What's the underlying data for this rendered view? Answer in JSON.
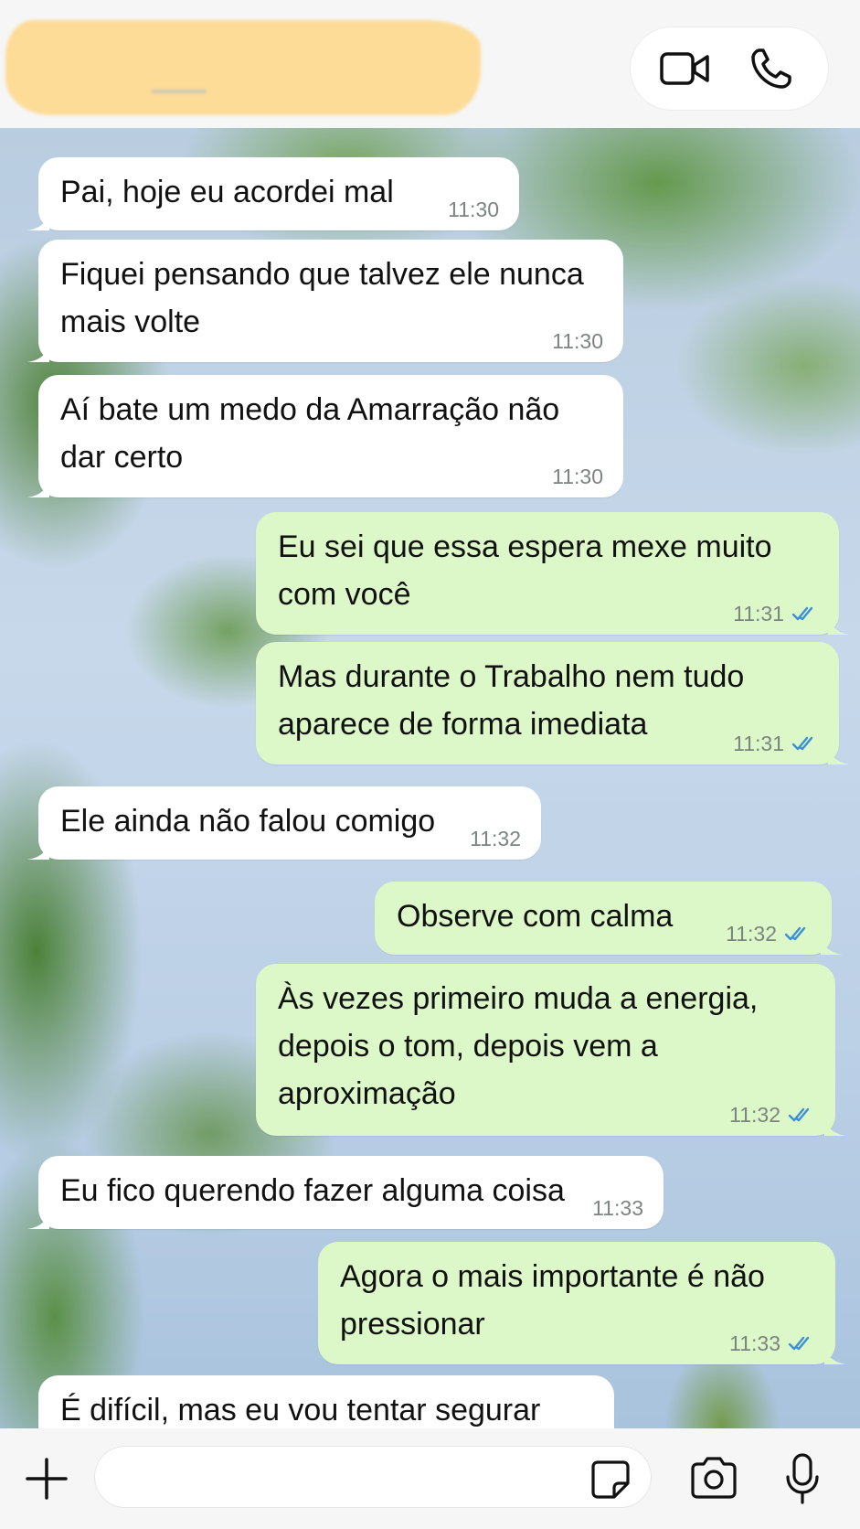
{
  "header": {
    "contact_name_redacted": "",
    "video_call_label": "video-call",
    "voice_call_label": "voice-call"
  },
  "messages": [
    {
      "dir": "in",
      "text": "Pai, hoje eu acordei mal",
      "time": "11:30"
    },
    {
      "dir": "in",
      "text": "Fiquei pensando que talvez ele nunca\nmais volte",
      "time": "11:30"
    },
    {
      "dir": "in",
      "text": "Aí bate um medo da Amarração não\ndar certo",
      "time": "11:30"
    },
    {
      "dir": "out",
      "text": "Eu sei que essa espera mexe muito\ncom você",
      "time": "11:31",
      "read": true
    },
    {
      "dir": "out",
      "text": "Mas durante o Trabalho nem tudo\naparece de forma imediata",
      "time": "11:31",
      "read": true
    },
    {
      "dir": "in",
      "text": "Ele ainda não falou comigo",
      "time": "11:32"
    },
    {
      "dir": "out",
      "text": "Observe com calma",
      "time": "11:32",
      "read": true
    },
    {
      "dir": "out",
      "text": "Às vezes primeiro muda a energia,\ndepois o tom, depois vem a\naproximação",
      "time": "11:32",
      "read": true
    },
    {
      "dir": "in",
      "text": "Eu fico querendo fazer alguma coisa",
      "time": "11:33"
    },
    {
      "dir": "out",
      "text": "Agora o mais importante é não\npressionar",
      "time": "11:33",
      "read": true
    },
    {
      "dir": "in",
      "text": "É difícil, mas eu vou tentar segurar",
      "time": ""
    }
  ],
  "composer": {
    "placeholder": "",
    "icons": [
      "plus-icon",
      "sticker-icon",
      "camera-icon",
      "microphone-icon"
    ]
  },
  "colors": {
    "incoming_bubble": "#ffffff",
    "outgoing_bubble": "#ddf8c8",
    "read_ticks": "#3b8fd9",
    "timestamp": "#7c8480"
  }
}
